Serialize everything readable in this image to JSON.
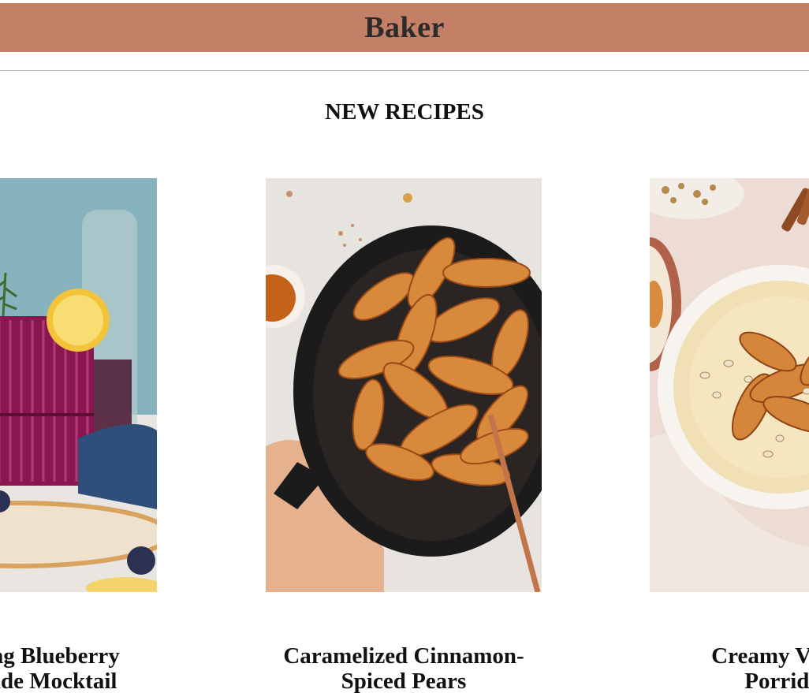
{
  "banner": {
    "title": "Baker"
  },
  "section": {
    "title": "NEW RECIPES"
  },
  "recipes": [
    {
      "title_line1": "Sparkling Blueberry",
      "title_line2": "Lemonade Mocktail",
      "photo": "blueberry-mocktail-photo"
    },
    {
      "title_line1": "Caramelized Cinnamon-",
      "title_line2": "Spiced Pears",
      "photo": "caramelized-pears-photo"
    },
    {
      "title_line1": "Creamy Vanilla",
      "title_line2": "Porridge",
      "photo": "vanilla-porridge-photo"
    }
  ],
  "colors": {
    "banner": "#c48066",
    "divider": "#b8b8b8",
    "text": "#111111"
  }
}
